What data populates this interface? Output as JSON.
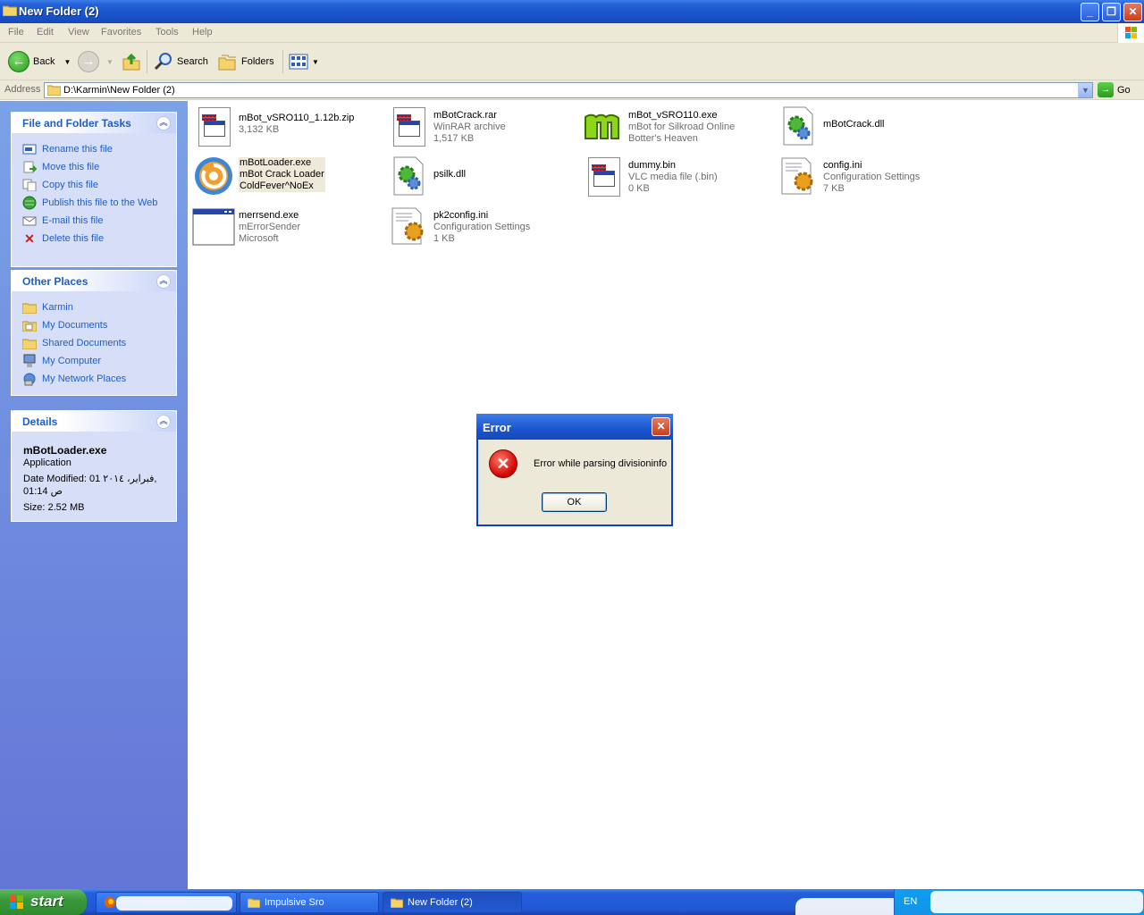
{
  "window": {
    "title": "New Folder (2)"
  },
  "menu": [
    "File",
    "Edit",
    "View",
    "Favorites",
    "Tools",
    "Help"
  ],
  "toolbar": {
    "back": "Back",
    "search": "Search",
    "folders": "Folders"
  },
  "address": {
    "label": "Address",
    "path": "D:\\Karmin\\New Folder (2)",
    "go": "Go"
  },
  "file_tasks": {
    "title": "File and Folder Tasks",
    "items": [
      "Rename this file",
      "Move this file",
      "Copy this file",
      "Publish this file to the Web",
      "E-mail this file",
      "Delete this file"
    ]
  },
  "other_places": {
    "title": "Other Places",
    "items": [
      "Karmin",
      "My Documents",
      "Shared Documents",
      "My Computer",
      "My Network Places"
    ]
  },
  "details": {
    "title": "Details",
    "name": "mBotLoader.exe",
    "type": "Application",
    "modified": "Date Modified: 01 فبراير، ٢٠١٤,",
    "modified_time": "01:14 ص",
    "size": "Size: 2.52 MB"
  },
  "files": [
    {
      "name": "mBot_vSRO110_1.12b.zip",
      "l2": "3,132 KB",
      "l3": ""
    },
    {
      "name": "mBotCrack.rar",
      "l2": "WinRAR archive",
      "l3": "1,517 KB"
    },
    {
      "name": "mBot_vSRO110.exe",
      "l2": "mBot for Silkroad Online",
      "l3": "Botter's Heaven"
    },
    {
      "name": "mBotCrack.dll",
      "l2": "",
      "l3": ""
    },
    {
      "name": "mBotLoader.exe",
      "l2": "mBot Crack Loader",
      "l3": "ColdFever^NoEx"
    },
    {
      "name": "psilk.dll",
      "l2": "",
      "l3": ""
    },
    {
      "name": "dummy.bin",
      "l2": "VLC media file (.bin)",
      "l3": "0 KB"
    },
    {
      "name": "config.ini",
      "l2": "Configuration Settings",
      "l3": "7 KB"
    },
    {
      "name": "merrsend.exe",
      "l2": "mErrorSender",
      "l3": "Microsoft"
    },
    {
      "name": "pk2config.ini",
      "l2": "Configuration Settings",
      "l3": "1 KB"
    }
  ],
  "dialog": {
    "title": "Error",
    "message": "Error while parsing divisioninfo",
    "ok": "OK"
  },
  "taskbar": {
    "start": "start",
    "buttons": [
      "Impulsive Sro",
      "New Folder (2)"
    ],
    "lang": "EN"
  }
}
